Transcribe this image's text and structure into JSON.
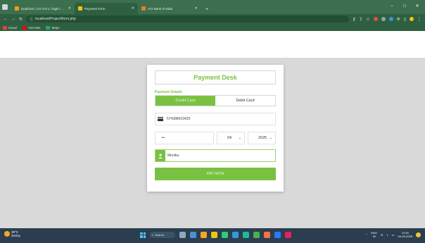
{
  "browser": {
    "tabs": [
      {
        "title": "localhost / 127.0.0.1 / login / cgu",
        "color": "#f39c12",
        "active": false
      },
      {
        "title": "Payment Form",
        "color": "#f1c40f",
        "active": true
      },
      {
        "title": "ACI Bank of India",
        "color": "#e67e22",
        "active": false
      }
    ],
    "new_tab": "+",
    "url": "localhost/Project/form.php",
    "bookmarks": [
      {
        "label": "Gmail",
        "color": "#ea4335"
      },
      {
        "label": "YouTube",
        "color": "#ff0000"
      },
      {
        "label": "Maps",
        "color": "#34a853"
      }
    ],
    "window_controls": {
      "minimize": "–",
      "maximize": "□",
      "close": "✕"
    }
  },
  "payment": {
    "title": "Payment Desk",
    "section_label": "Payment Details",
    "tab_credit": "Credit Card",
    "tab_debit": "Debit Card",
    "card_number": "574388423435",
    "cvv": "•••",
    "month": "04",
    "year": "2025",
    "name": "Monika",
    "pay_button": "PAY NOW"
  },
  "taskbar": {
    "temperature": "29°C",
    "weather_desc": "Sunny",
    "search": "Search",
    "lang_top": "ENG",
    "lang_bottom": "IN",
    "time": "12:45",
    "date": "04-03-2025"
  },
  "colors": {
    "accent": "#7ac142",
    "chrome": "#2f5f41",
    "taskbar": "#2b3e4f"
  }
}
